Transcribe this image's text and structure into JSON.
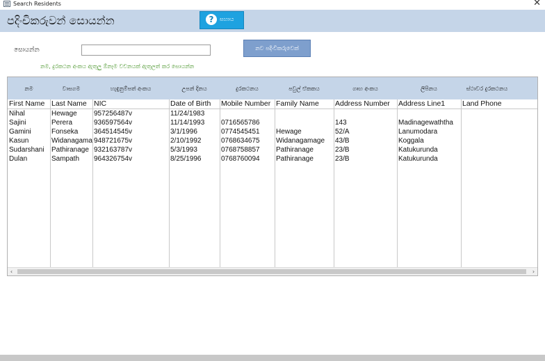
{
  "window": {
    "title": "Search Residents",
    "close_glyph": "✕"
  },
  "header": {
    "heading": "පදිංචිකරුවන් සොයන්න",
    "help_label": "සහාය",
    "help_icon_glyph": "?"
  },
  "search": {
    "label": "සොයන්න",
    "value": "",
    "placeholder": "",
    "new_button_label": "නව පදිංචිකරුවෙක්",
    "hint": "නම, දුරකථන අංකය ඇතුලු ඕනෑම වචනයක් ඇතුලත් කර සොයන්න"
  },
  "grid": {
    "columns": [
      {
        "sinhala": "නම",
        "field": "First Name"
      },
      {
        "sinhala": "වාසගම",
        "field": "Last Name"
      },
      {
        "sinhala": "හැඳුනුම්පත් අංකය",
        "field": "NIC"
      },
      {
        "sinhala": "උපන් දිනය",
        "field": "Date of Birth"
      },
      {
        "sinhala": "දුරකථනය",
        "field": "Mobile Number"
      },
      {
        "sinhala": "පවුල් ඒකකය",
        "field": "Family Name"
      },
      {
        "sinhala": "ගෘහ අංකය",
        "field": "Address Number"
      },
      {
        "sinhala": "ලිපිනය",
        "field": "Address Line1"
      },
      {
        "sinhala": "ස්ථාවර දුරකථනය",
        "field": "Land Phone"
      }
    ],
    "rows": [
      [
        "Nihal",
        "Hewage",
        "957256487v",
        "11/24/1983",
        "",
        "",
        "",
        "",
        ""
      ],
      [
        "Sajini",
        "Perera",
        "936597564v",
        "11/14/1993",
        "0716565786",
        "",
        "143",
        "Madinagewaththa",
        ""
      ],
      [
        "Gamini",
        "Fonseka",
        "364514545v",
        "3/1/1996",
        "0774545451",
        "Hewage",
        "52/A",
        "Lanumodara",
        ""
      ],
      [
        "Kasun",
        "Widanagamage",
        "948721675v",
        "2/10/1992",
        "0768634675",
        "Widanagamage",
        "43/B",
        "Koggala",
        ""
      ],
      [
        "Sudarshani",
        "Pathiranage",
        "932163787v",
        "5/3/1993",
        "0768758857",
        "Pathiranage",
        "23/B",
        "Katukurunda",
        ""
      ],
      [
        "Dulan",
        "Sampath",
        "964326754v",
        "8/25/1996",
        "0768760094",
        "Pathiranage",
        "23/B",
        "Katukurunda",
        ""
      ]
    ],
    "scroll_left_glyph": "‹",
    "scroll_right_glyph": "›"
  }
}
